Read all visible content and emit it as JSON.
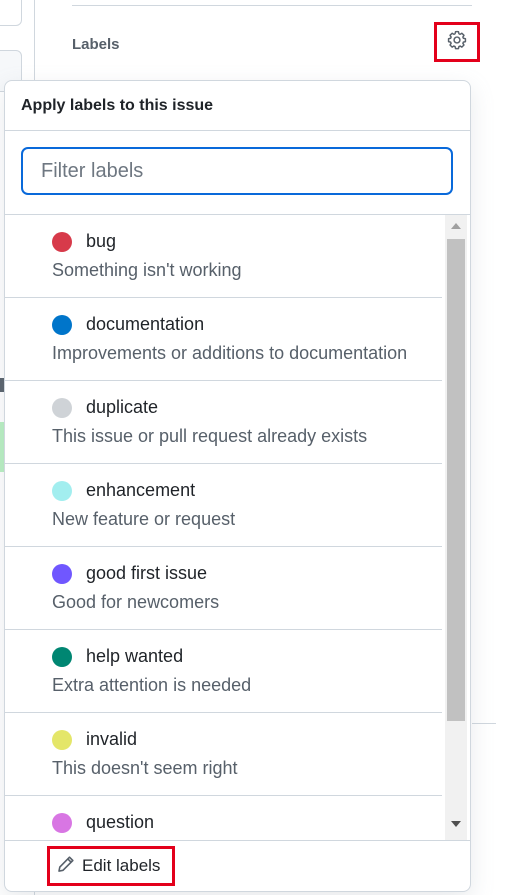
{
  "sidebar": {
    "labels_heading": "Labels",
    "gear_icon": "gear-icon"
  },
  "popover": {
    "title": "Apply labels to this issue",
    "filter": {
      "placeholder": "Filter labels",
      "value": ""
    },
    "labels": [
      {
        "name": "bug",
        "description": "Something isn't working",
        "color": "#d73a4a"
      },
      {
        "name": "documentation",
        "description": "Improvements or additions to documentation",
        "color": "#0075ca"
      },
      {
        "name": "duplicate",
        "description": "This issue or pull request already exists",
        "color": "#cfd3d7"
      },
      {
        "name": "enhancement",
        "description": "New feature or request",
        "color": "#a2eeef"
      },
      {
        "name": "good first issue",
        "description": "Good for newcomers",
        "color": "#7057ff"
      },
      {
        "name": "help wanted",
        "description": "Extra attention is needed",
        "color": "#008672"
      },
      {
        "name": "invalid",
        "description": "This doesn't seem right",
        "color": "#e4e669"
      },
      {
        "name": "question",
        "description": "",
        "color": "#d876e3"
      }
    ],
    "footer": {
      "edit_labels": "Edit labels",
      "icon": "pencil-icon"
    }
  },
  "colors": {
    "accent": "#0969da",
    "highlight": "#e3001b",
    "border": "#d0d7de"
  }
}
